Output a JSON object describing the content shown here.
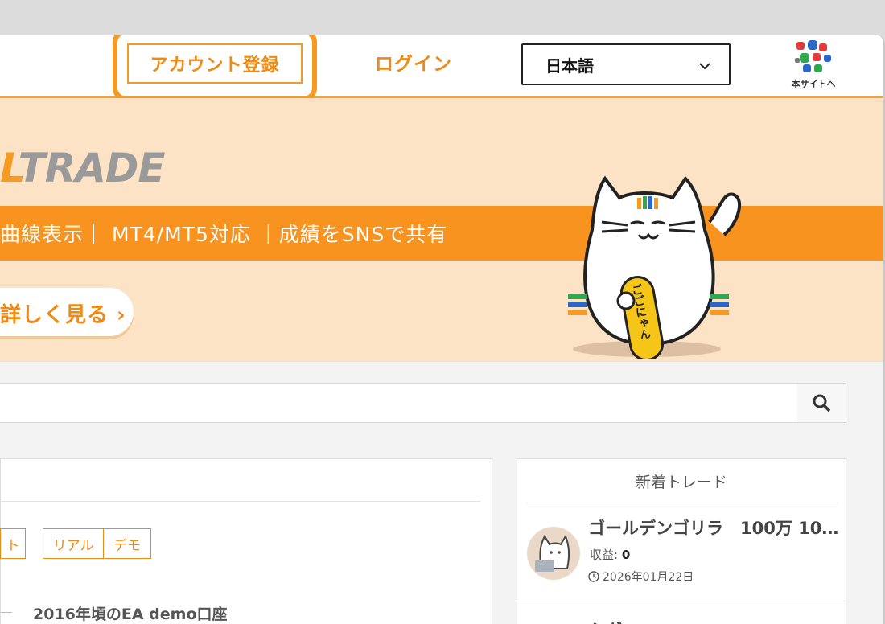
{
  "header": {
    "register_label": "アカウント登録",
    "login_label": "ログイン",
    "language": {
      "selected": "日本語"
    },
    "site_link_label": "本サイトへ"
  },
  "banner": {
    "brand_partial_orange": "L",
    "brand_partial_gray": "TRADE",
    "features_text": "曲線表示｜ MT4/MT5対応 ｜成績をSNSで共有",
    "details_button": "詳しく見る ›",
    "mascot_badge": "ごごにゃん"
  },
  "search": {
    "placeholder": ""
  },
  "left_panel": {
    "filters": [
      "ト",
      "リアル",
      "デモ"
    ],
    "items": [
      {
        "title": "2016年頃のEA demo口座"
      }
    ]
  },
  "right_panel": {
    "title": "新着トレード",
    "trades": [
      {
        "name": "ゴールデンゴリラ　100万 10…",
        "profit_label": "収益:",
        "profit_value": "0",
        "date": "2026年01月22日"
      },
      {
        "name": "シグマ…"
      }
    ]
  },
  "colors": {
    "accent": "#f59a22",
    "banner_bg": "#fde3c6",
    "stripe": "#f7931e"
  }
}
